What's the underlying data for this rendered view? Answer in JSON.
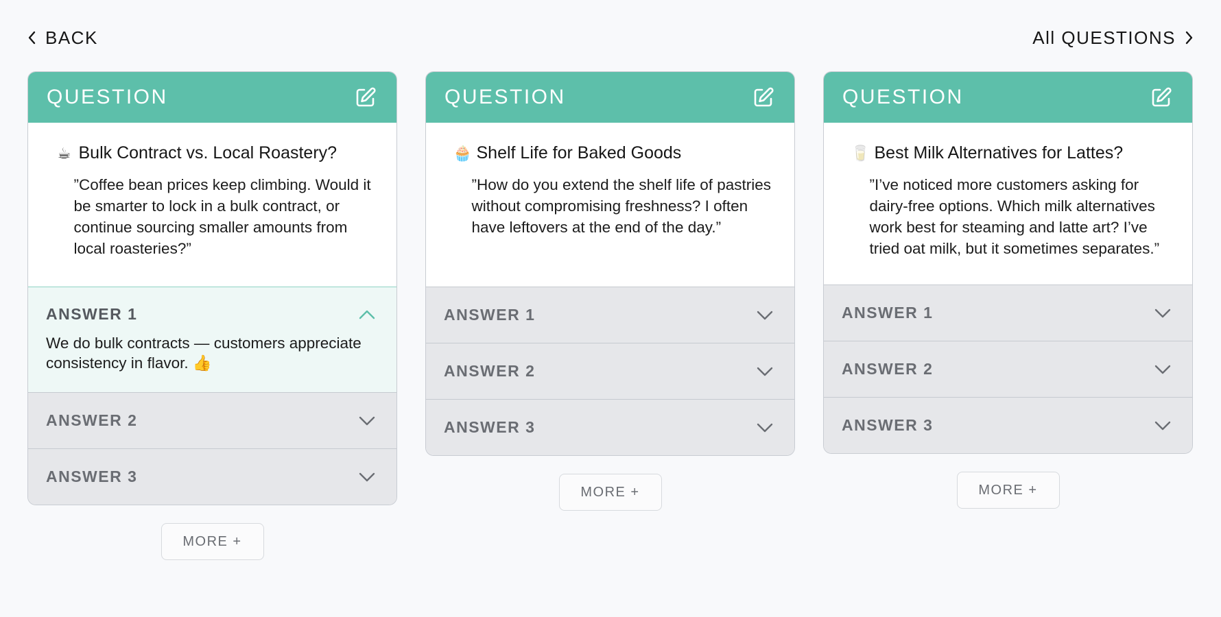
{
  "nav": {
    "back_label": "BACK",
    "all_questions_label": "All QUESTIONS"
  },
  "colors": {
    "header_teal": "#5dbfaa",
    "answer_open_bg": "#eef8f6",
    "answer_closed_bg": "#e6e7ea",
    "page_bg": "#f8f9fb"
  },
  "columns": [
    {
      "header": "QUESTION",
      "emoji": "☕",
      "title": "Bulk Contract vs. Local Roastery?",
      "text": "”Coffee bean prices keep climbing. Would it be smarter to lock in a bulk contract, or continue sourcing smaller amounts from local roasteries?”",
      "answers": [
        {
          "label": "ANSWER 1",
          "expanded": true,
          "text": "We do bulk contracts — customers appreciate consistency in flavor. 👍"
        },
        {
          "label": "ANSWER 2",
          "expanded": false
        },
        {
          "label": "ANSWER 3",
          "expanded": false
        }
      ],
      "more_label": "MORE +"
    },
    {
      "header": "QUESTION",
      "emoji": "🧁",
      "title": "Shelf Life for Baked Goods",
      "text": "”How do you extend the shelf life of pastries without compromising freshness? I often have leftovers at the end of the day.”",
      "answers": [
        {
          "label": "ANSWER 1",
          "expanded": false
        },
        {
          "label": "ANSWER 2",
          "expanded": false
        },
        {
          "label": "ANSWER 3",
          "expanded": false
        }
      ],
      "more_label": "MORE +"
    },
    {
      "header": "QUESTION",
      "emoji": "🥛",
      "title": "Best Milk Alternatives for Lattes?",
      "text": "”I’ve noticed more customers asking for dairy-free options. Which milk alternatives work best for steaming and latte art? I’ve tried oat milk, but it sometimes separates.”",
      "answers": [
        {
          "label": "ANSWER 1",
          "expanded": false
        },
        {
          "label": "ANSWER 2",
          "expanded": false
        },
        {
          "label": "ANSWER 3",
          "expanded": false
        }
      ],
      "more_label": "MORE +"
    }
  ]
}
